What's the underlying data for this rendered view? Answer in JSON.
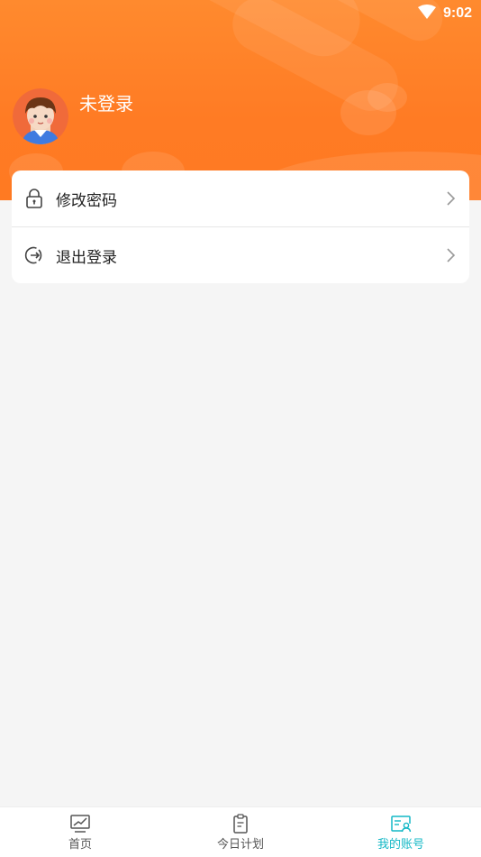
{
  "status_bar": {
    "time": "9:02",
    "wifi_icon": "wifi-icon"
  },
  "profile": {
    "username": "未登录",
    "avatar_icon": "avatar-boy-icon"
  },
  "menu": {
    "items": [
      {
        "label": "修改密码",
        "icon": "lock-icon"
      },
      {
        "label": "退出登录",
        "icon": "logout-icon"
      }
    ]
  },
  "tabbar": {
    "items": [
      {
        "label": "首页",
        "icon": "chart-icon"
      },
      {
        "label": "今日计划",
        "icon": "clipboard-icon"
      },
      {
        "label": "我的账号",
        "icon": "account-card-icon",
        "active": true
      }
    ]
  },
  "colors": {
    "brand_orange": "#ff7b24",
    "active_tab": "#14b8c6",
    "background": "#f5f5f5"
  }
}
